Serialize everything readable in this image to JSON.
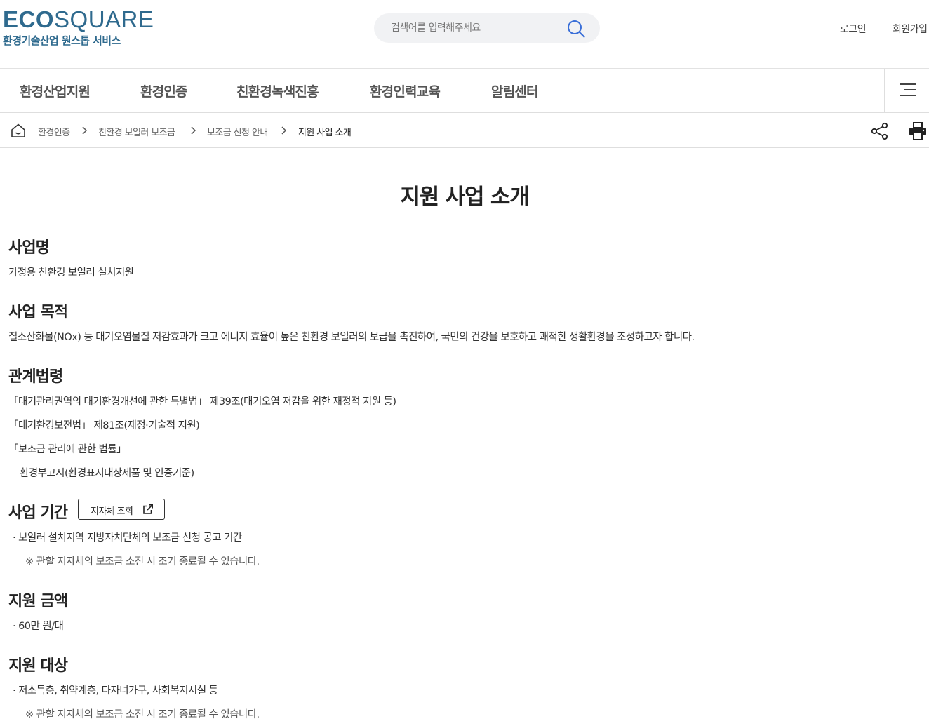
{
  "header": {
    "logo_eco": "ECO",
    "logo_square": "SQUARE",
    "logo_sub": "환경기술산업 원스톱 서비스",
    "search_placeholder": "검색어를 입력해주세요",
    "login": "로그인",
    "join": "회원가입"
  },
  "gnb": [
    "환경산업지원",
    "환경인증",
    "친환경녹색진흥",
    "환경인력교육",
    "알림센터"
  ],
  "breadcrumb": [
    "환경인증",
    "친환경 보일러 보조금",
    "보조금 신청 안내",
    "지원 사업 소개"
  ],
  "page_title": "지원 사업 소개",
  "sections": {
    "name": {
      "title": "사업명",
      "text": "가정용 친환경 보일러 설치지원"
    },
    "purpose": {
      "title": "사업 목적",
      "text": "질소산화물(NOx) 등 대기오염물질 저감효과가 크고 에너지 효율이 높은 친환경 보일러의 보급을 촉진하여, 국민의 건강을 보호하고 쾌적한 생활환경을 조성하고자 합니다."
    },
    "laws": {
      "title": "관계법령",
      "items": [
        "「대기관리권역의 대기환경개선에 관한 특별법」 제39조(대기오염 저감을 위한 재정적 지원 등)",
        "「대기환경보전법」 제81조(재정·기술적 지원)",
        "「보조금 관리에 관한 법률」",
        "환경부고시(환경표지대상제품 및 인증기준)"
      ]
    },
    "period": {
      "title": "사업 기간",
      "button": "지자체 조회",
      "text": "· 보일러 설치지역 지방자치단체의 보조금 신청 공고 기간",
      "note": "※ 관할 지자체의 보조금 소진 시 조기 종료될 수 있습니다."
    },
    "amount": {
      "title": "지원 금액",
      "text": "· 60만 원/대"
    },
    "target": {
      "title": "지원 대상",
      "text": "· 저소득층, 취약계층, 다자녀가구, 사회복지시설 등",
      "note": "※ 관할 지자체의 보조금 소진 시 조기 종료될 수 있습니다."
    }
  },
  "colors": {
    "brand": "#2f6a8e",
    "search_icon": "#3a6fd8"
  },
  "icons": [
    "search-icon",
    "menu-icon",
    "home-icon",
    "chevron-right-icon",
    "share-icon",
    "print-icon",
    "external-link-icon"
  ]
}
